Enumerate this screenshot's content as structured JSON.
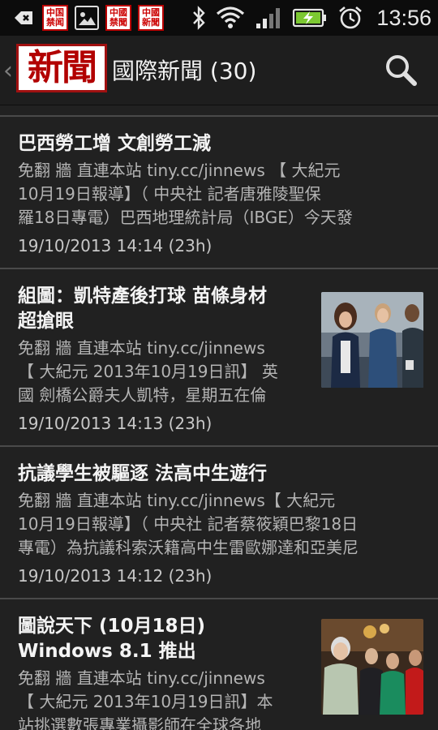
{
  "status_bar": {
    "time": "13:56",
    "mini_logo_text": [
      "中国",
      "禁闻"
    ],
    "mini_logo2_text": [
      "中國",
      "禁聞"
    ],
    "mini_logo3_text": [
      "中國",
      "新聞"
    ],
    "icons": [
      "back-notification-icon",
      "app-notification-icon",
      "image-notification-icon",
      "bluetooth-icon",
      "wifi-icon",
      "signal-icon",
      "battery-charging-icon",
      "alarm-icon"
    ]
  },
  "header": {
    "logo_text": "新聞",
    "title": "國際新聞 (30)"
  },
  "articles": [
    {
      "title": "巴西勞工增 文創勞工減",
      "snippet": "免翻 牆 直連本站 tiny.cc/jinnews 【 大紀元\n10月19日報導】（ 中央社 記者唐雅陵聖保\n羅18日專電）巴西地理統計局（IBGE）今天發",
      "date": "19/10/2013 14:14 (23h)"
    },
    {
      "title": "組圖：凱特產後打球 苗條身材\n超搶眼",
      "snippet": "免翻 牆 直連本站 tiny.cc/jinnews\n【 大紀元 2013年10月19日訊】 英\n國 劍橋公爵夫人凱特，星期五在倫",
      "date": "19/10/2013 14:13 (23h)"
    },
    {
      "title": "抗議學生被驅逐 法高中生遊行",
      "snippet": "免翻 牆 直連本站 tiny.cc/jinnews【 大紀元\n10月19日報導】（ 中央社 記者蔡筱穎巴黎18日\n專電）為抗議科索沃籍高中生雷歐娜達和亞美尼",
      "date": "19/10/2013 14:12 (23h)"
    },
    {
      "title": "圖說天下 (10月18日)\nWindows 8.1 推出",
      "snippet": "免翻 牆 直連本站 tiny.cc/jinnews\n【 大紀元 2013年10月19日訊】本\n站挑選數張專業攝影師在全球各地",
      "date": ""
    }
  ],
  "colors": {
    "background": "#212121",
    "status_bar": "#0c0c0c",
    "divider": "#4a4a4a",
    "logo_red": "#b20000",
    "snippet_gray": "#b4b4b4"
  }
}
